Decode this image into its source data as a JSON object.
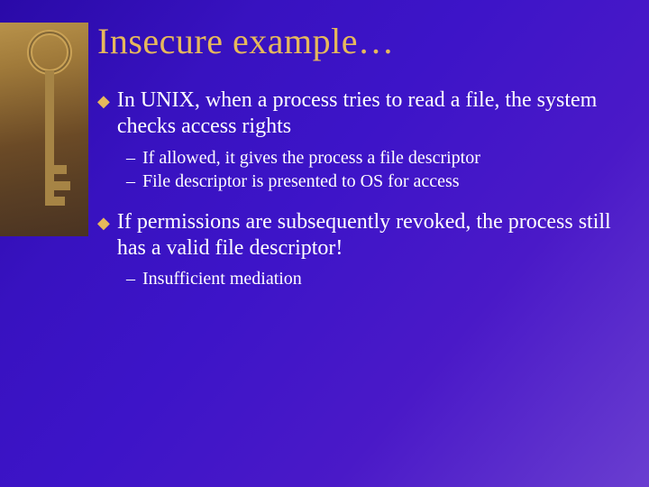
{
  "title": "Insecure example…",
  "bullets": [
    {
      "text": "In UNIX, when a process tries to read a file, the system checks access rights",
      "subs": [
        "If allowed, it gives the process a file descriptor",
        "File descriptor is presented to OS for access"
      ]
    },
    {
      "text": "If permissions are subsequently revoked, the process still has a valid file descriptor!",
      "subs": [
        "Insufficient mediation"
      ]
    }
  ]
}
